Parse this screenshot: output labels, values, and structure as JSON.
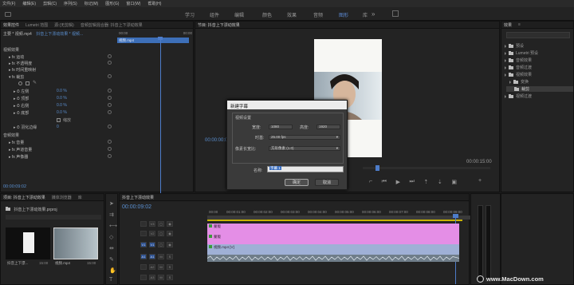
{
  "menu": [
    "文件(F)",
    "编辑(E)",
    "剪辑(C)",
    "序列(S)",
    "标记(M)",
    "图形(G)",
    "窗口(W)",
    "帮助(H)"
  ],
  "workspaces": [
    "学习",
    "组件",
    "编辑",
    "颜色",
    "效果",
    "音频",
    "图形",
    "库"
  ],
  "active_workspace": "图形",
  "effect_controls": {
    "tabs": [
      "效果控件",
      "Lumetri 范围",
      "源:(无剪辑)",
      "音频剪辑混合器: 抖音上下漂动效果"
    ],
    "source_label": "主要 * 视频.mp4",
    "sequence_label": "抖音上下漂动效果 * 视频...",
    "section_video": "视频效果",
    "section_audio": "音频效果",
    "rows": [
      "运动",
      "不透明度",
      "时间重映射",
      "裁剪",
      "左侧",
      "顶部",
      "右侧",
      "底部",
      "羽化边缘",
      "音量",
      "声道音量",
      "声像器"
    ],
    "percent_values": [
      "0.0 %",
      "0.0 %",
      "0.0 %",
      "0.0 %"
    ],
    "zoom_label": "缩放",
    "feather_value": "0",
    "time_start": "00:00",
    "time_end": "00:00",
    "clip_label": "视频.mp4",
    "timecode": "00:00:09:02"
  },
  "program_monitor": {
    "title": "节目: 抖音上下漂动效果",
    "timecode": "00:00:00:00",
    "duration": "00:00:15:00"
  },
  "dialog": {
    "title": "新建字幕",
    "section": "视频设置",
    "width_label": "宽度:",
    "width_value": "1080",
    "height_label": "高度:",
    "height_value": "1920",
    "timebase_label": "时基:",
    "timebase_value": "25.00 fps",
    "par_label": "像素长宽比:",
    "par_value": "方形像素 (1.0)",
    "name_label": "名称:",
    "name_value": "字幕 1",
    "ok_label": "确定",
    "cancel_label": "取消"
  },
  "project": {
    "tabs": [
      "效果",
      "≡"
    ],
    "items": [
      "预设",
      "Lumetri 预设",
      "音频效果",
      "音频过渡",
      "视频效果",
      "变换",
      "裁剪",
      "视频过渡"
    ]
  },
  "project_bin": {
    "tabs": [
      "项目: 抖音上下漂动效果",
      "媒体浏览器",
      "库"
    ],
    "path": "抖音上下漂动效果.prproj",
    "item1_name": "抖音上下漂...",
    "item1_dur": "15:00",
    "item2_name": "视频.mp4",
    "item2_dur": "15:00"
  },
  "timeline": {
    "tab": "抖音上下漂动效果",
    "timecode": "00:00:09:02",
    "ruler": [
      "00:00",
      "00:00:01:00",
      "00:00:02:00",
      "00:00:03:00",
      "00:00:04:00",
      "00:00:05:00",
      "00:00:06:00",
      "00:00:07:00",
      "00:00:08:00",
      "00:00:09:00"
    ],
    "tracks": [
      "V3",
      "V2",
      "V1",
      "A1",
      "A2",
      "A3"
    ],
    "track_buttons": [
      "V1",
      "A1"
    ],
    "clips": [
      "蒙版",
      "蒙版",
      "视频.mp4 [V]"
    ]
  },
  "watermark": "www.MacDown.com",
  "colors": {
    "accent": "#5c8bd6",
    "clip_pink": "#e48ee6",
    "clip_blue": "#9fb0d6"
  }
}
